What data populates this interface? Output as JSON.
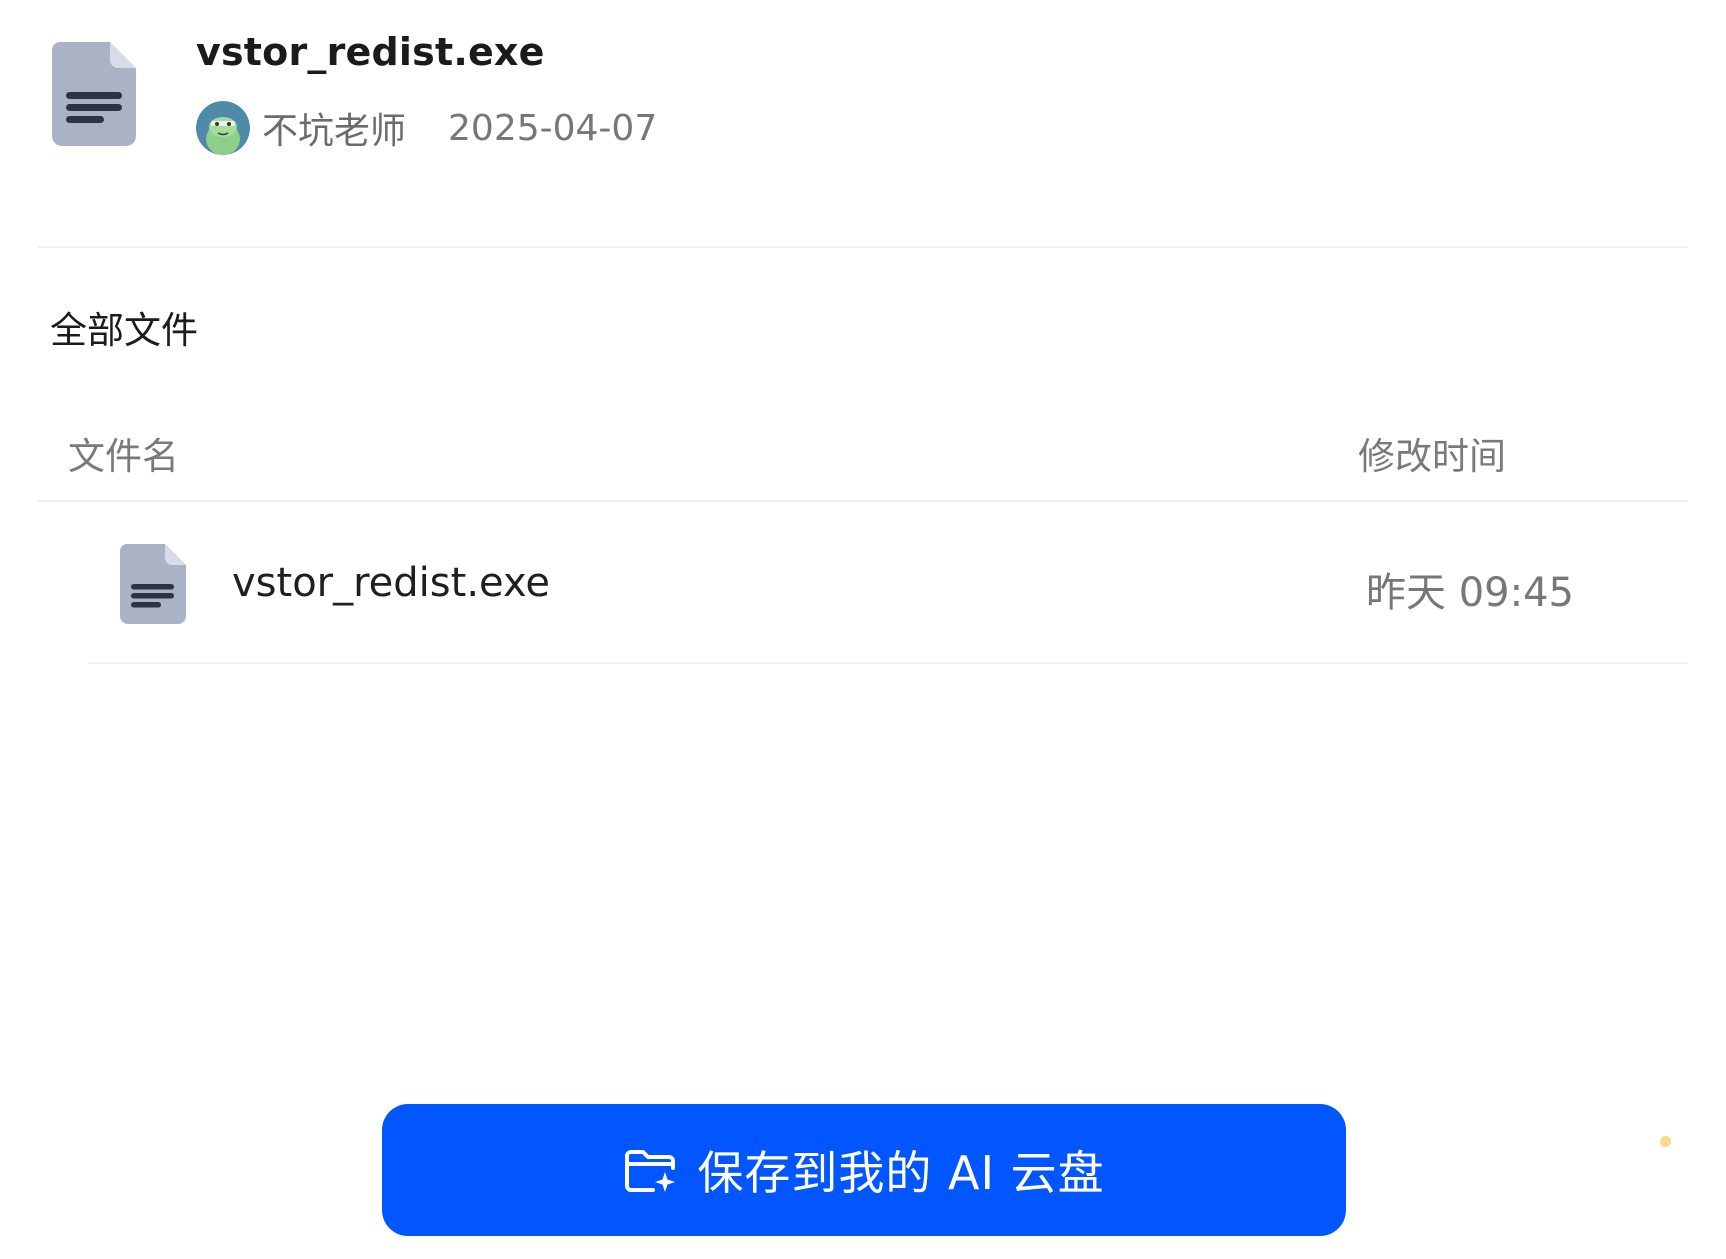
{
  "header": {
    "file_title": "vstor_redist.exe",
    "owner_name": "不坑老师",
    "share_date": "2025-04-07",
    "file_icon": "document-icon",
    "avatar_icon": "avatar"
  },
  "section": {
    "title": "全部文件"
  },
  "table": {
    "columns": {
      "name": "文件名",
      "modified": "修改时间"
    },
    "rows": [
      {
        "icon": "document-icon",
        "name": "vstor_redist.exe",
        "modified": "昨天 09:45"
      }
    ]
  },
  "save_button": {
    "label": "保存到我的 AI 云盘",
    "icon": "folder-sparkle-icon"
  },
  "colors": {
    "accent": "#0256ff",
    "file_icon_body": "#aab3c5",
    "file_icon_lines": "#2c3346",
    "divider": "#f0f0f0",
    "secondary_text": "#777777"
  }
}
